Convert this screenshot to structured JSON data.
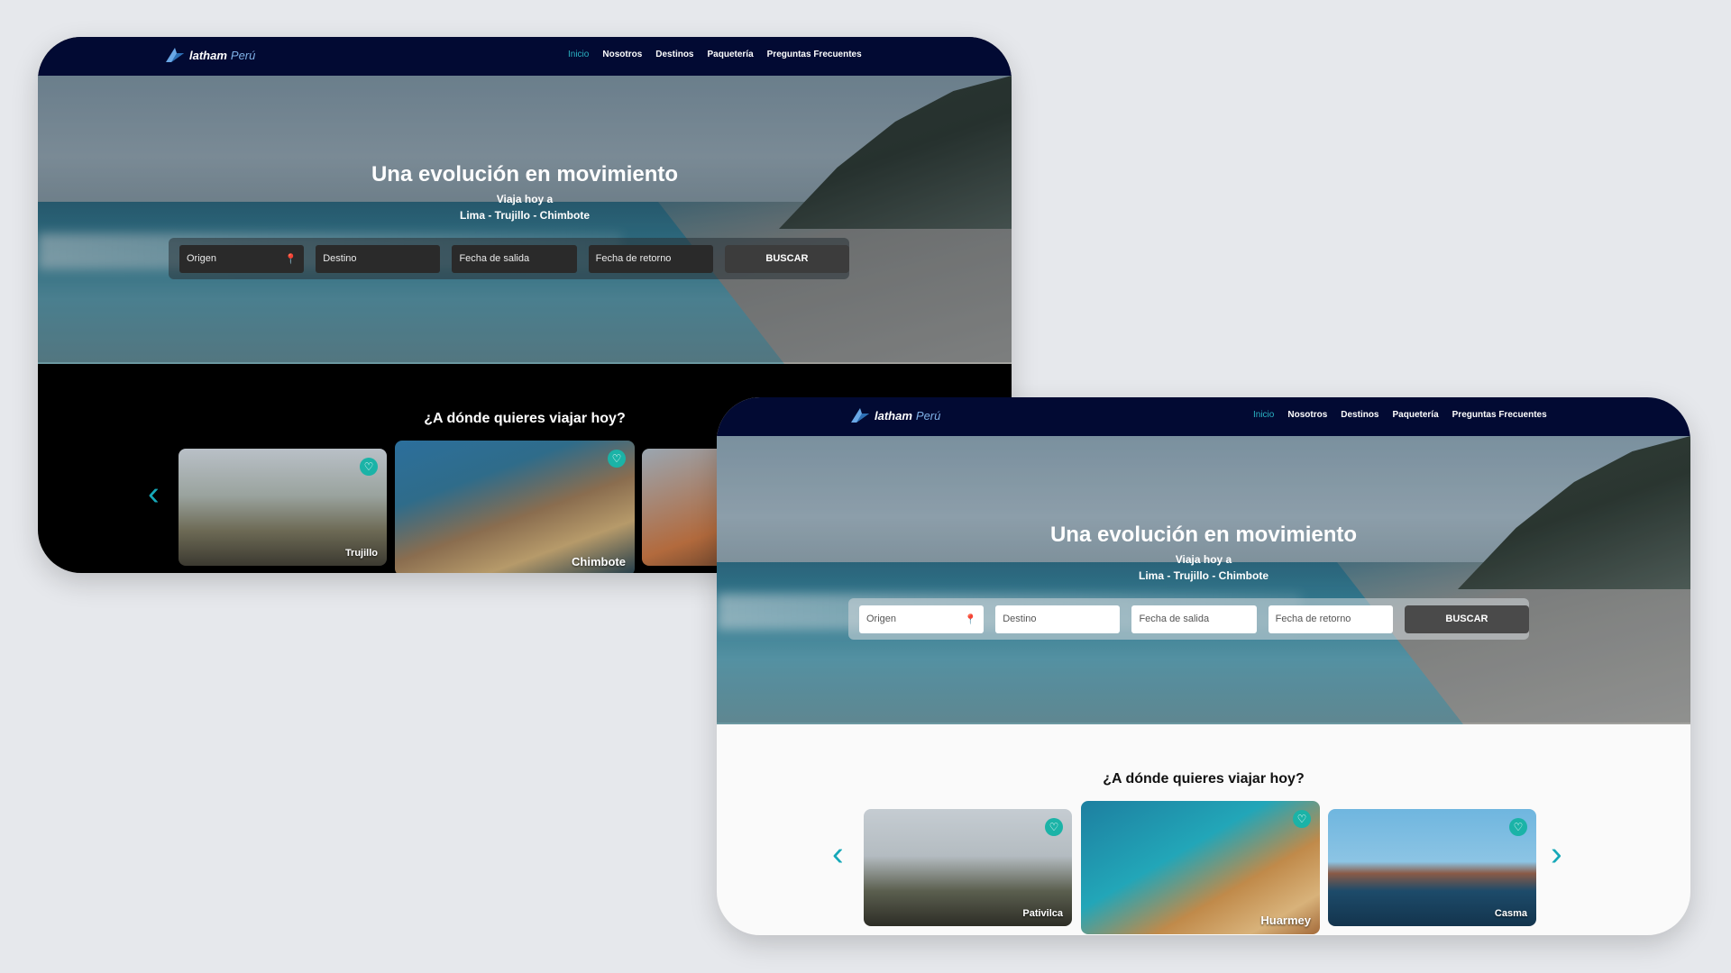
{
  "brand": {
    "name": "latham",
    "suffix": "Perú"
  },
  "nav": {
    "items": [
      "Inicio",
      "Nosotros",
      "Destinos",
      "Paquetería",
      "Preguntas Frecuentes"
    ],
    "active": "Inicio"
  },
  "hero": {
    "title": "Una evolución en movimiento",
    "subtitle_line1": "Viaja hoy a",
    "subtitle_line2": "Lima - Trujillo - Chimbote"
  },
  "search": {
    "origin": "Origen",
    "destination": "Destino",
    "departure": "Fecha de salida",
    "return": "Fecha de retorno",
    "button": "BUSCAR"
  },
  "section": {
    "title": "¿A dónde quieres viajar hoy?"
  },
  "dark_cards": [
    "Trujillo",
    "Chimbote"
  ],
  "light_cards": [
    "Pativilca",
    "Huarmey",
    "Casma"
  ],
  "colors": {
    "nav_bg": "#020a33",
    "accent": "#2ab3c4",
    "fav": "#1bb3a7"
  },
  "icons": {
    "prev": "chevron-left-icon",
    "next": "chevron-right-icon",
    "favorite": "heart-icon",
    "location": "pin-icon"
  }
}
